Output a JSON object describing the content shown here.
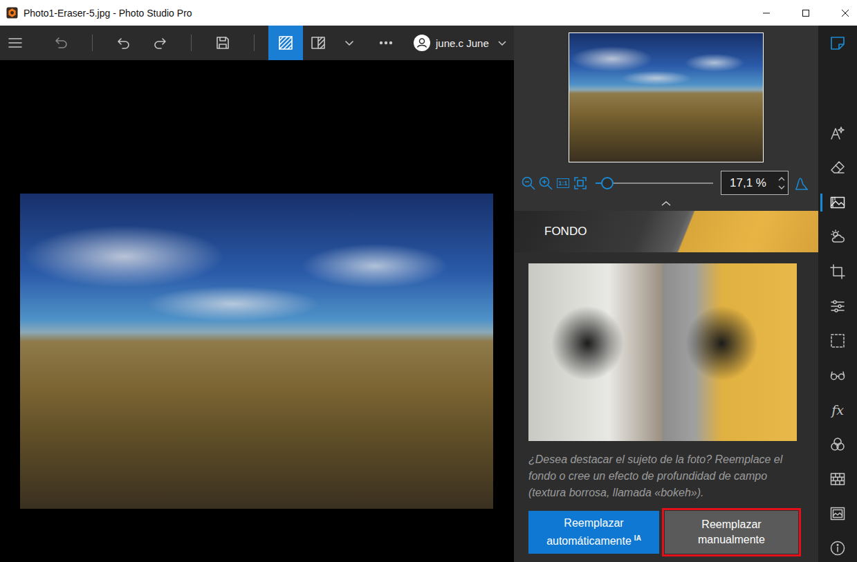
{
  "window": {
    "title": "Photo1-Eraser-5.jpg - Photo Studio Pro"
  },
  "toolbar": {
    "buttons": [
      {
        "selected": false
      },
      {
        "selected": false
      },
      {
        "selected": false
      },
      {
        "selected": false
      },
      {
        "selected": false
      },
      {
        "selected": true
      },
      {
        "selected": false
      },
      {
        "selected": false
      },
      {
        "selected": false
      }
    ],
    "user": {
      "name": "june.c June"
    }
  },
  "navigator": {
    "zoom": {
      "value": "17,1 %",
      "level": 0.1,
      "actual_size_label": "1:1"
    }
  },
  "panel": {
    "title": "FONDO",
    "description": "¿Desea destacar el sujeto de la foto? Reemplace el fondo o cree un efecto de profundidad de campo (textura borrosa, llamada «bokeh»).",
    "buttons": [
      {
        "label": "Reemplazar automáticamente",
        "badge": "IA",
        "kind": "primary",
        "highlighted": false
      },
      {
        "label": "Reemplazar manualmente",
        "kind": "secondary",
        "highlighted": true
      }
    ]
  },
  "rail": {
    "panel_toggle": {
      "on": true
    },
    "tools": [
      {
        "selected": false
      },
      {
        "selected": false
      },
      {
        "selected": true
      },
      {
        "selected": false
      },
      {
        "selected": false
      },
      {
        "selected": false
      },
      {
        "selected": false
      },
      {
        "selected": false
      },
      {
        "selected": false,
        "text": "fx"
      },
      {
        "selected": false
      },
      {
        "selected": false
      },
      {
        "selected": false
      },
      {
        "selected": false
      }
    ]
  }
}
